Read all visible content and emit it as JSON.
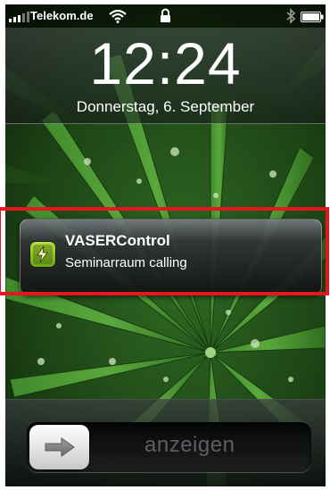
{
  "status_bar": {
    "carrier": "Telekom.de",
    "icons": [
      "signal-icon",
      "wifi-icon",
      "lock-icon",
      "bluetooth-icon",
      "battery-icon"
    ]
  },
  "lock_screen": {
    "time": "12:24",
    "date": "Donnerstag, 6. September"
  },
  "notification": {
    "app_name": "VASERControl",
    "message": "Seminarraum calling",
    "icon": "vasercontrol-app-icon",
    "highlight_color": "#e8141e"
  },
  "slider": {
    "label": "anzeigen",
    "knob_icon": "arrow-right-icon"
  }
}
